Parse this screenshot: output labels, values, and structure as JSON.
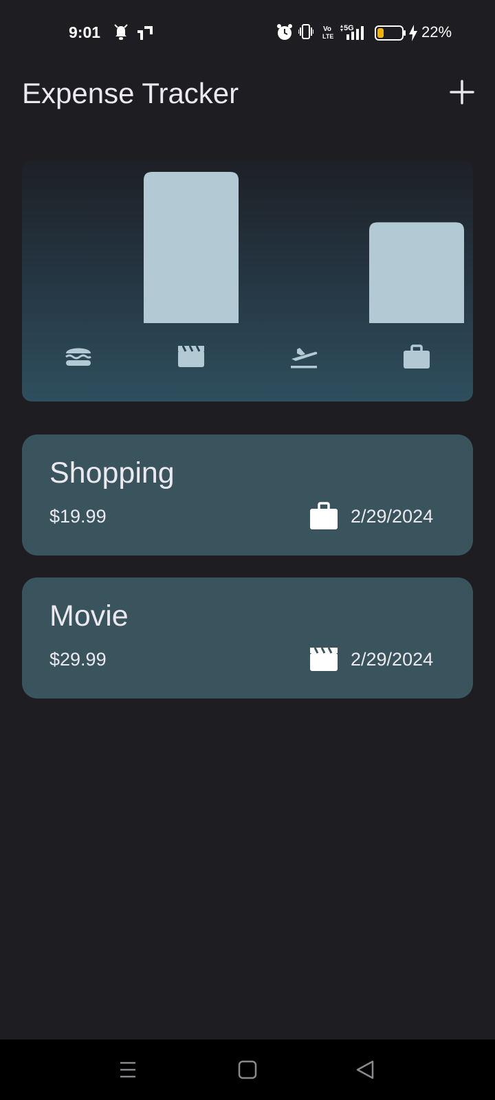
{
  "status_bar": {
    "time": "9:01",
    "battery_percent": "22%",
    "network": "5G",
    "volte": "Vo LTE",
    "icons": [
      "mute-bell-icon",
      "app-notification-icon",
      "alarm-icon",
      "vibrate-icon",
      "volte-icon",
      "signal-icon",
      "battery-icon",
      "charging-icon"
    ]
  },
  "app_bar": {
    "title": "Expense Tracker",
    "add_icon": "plus-icon"
  },
  "chart_data": {
    "type": "bar",
    "categories": [
      "food",
      "leisure",
      "travel",
      "work"
    ],
    "category_icons": [
      "burger-icon",
      "clapperboard-icon",
      "plane-takeoff-icon",
      "briefcase-icon"
    ],
    "values": [
      0,
      29.99,
      0,
      19.99
    ],
    "ylim": [
      0,
      29.99
    ],
    "bar_color": "#b3c9d4"
  },
  "expenses": [
    {
      "title": "Shopping",
      "amount": "$19.99",
      "date": "2/29/2024",
      "icon": "briefcase-icon"
    },
    {
      "title": "Movie",
      "amount": "$29.99",
      "date": "2/29/2024",
      "icon": "clapperboard-icon"
    }
  ],
  "nav_bar": {
    "icons": [
      "menu-icon",
      "home-icon",
      "back-icon"
    ]
  },
  "colors": {
    "background": "#1e1d22",
    "card": "#3a545e",
    "chart_bar": "#b3c9d4",
    "text": "#ece8ef"
  }
}
